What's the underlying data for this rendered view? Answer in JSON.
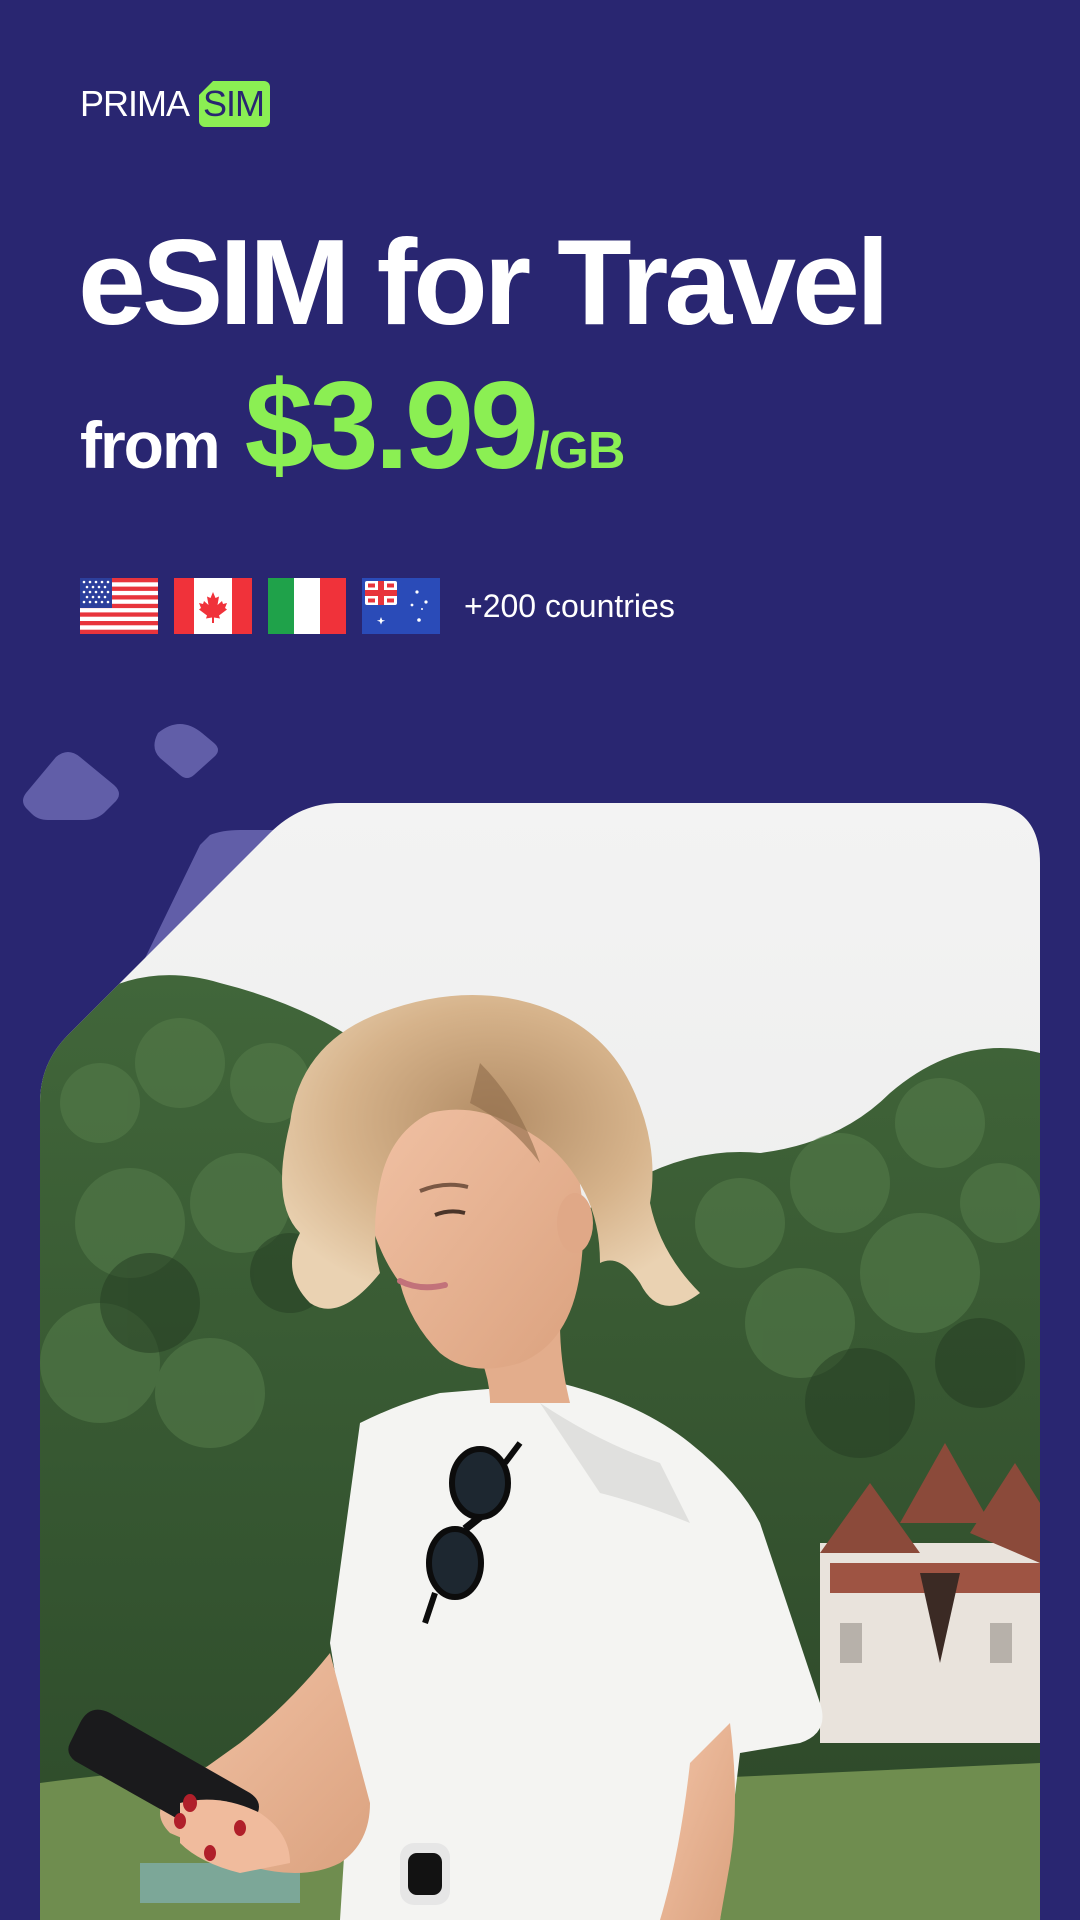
{
  "brand": {
    "name": "PRIMA",
    "badge": "SIM",
    "accent_color": "#8bef53",
    "background_color": "#292671"
  },
  "headline": "eSIM for Travel",
  "price": {
    "prefix": "from",
    "amount": "$3.99",
    "unit": "/GB"
  },
  "flags": [
    {
      "icon": "usa-flag-icon"
    },
    {
      "icon": "canada-flag-icon"
    },
    {
      "icon": "italy-flag-icon"
    },
    {
      "icon": "australia-flag-icon"
    }
  ],
  "countries_text": "+200 countries",
  "hero_image": {
    "icon": "woman-with-phone-photo"
  }
}
